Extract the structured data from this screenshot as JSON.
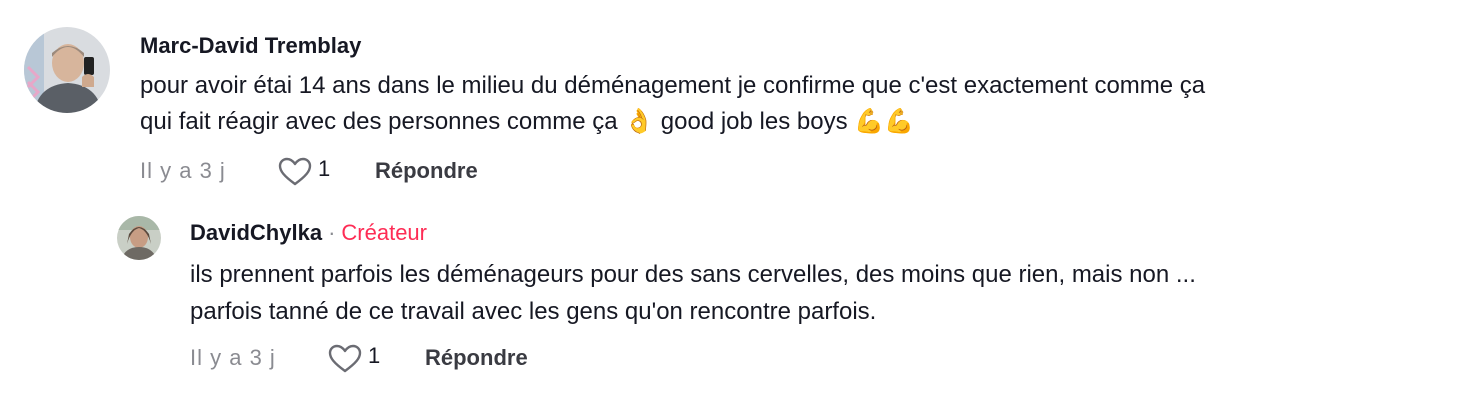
{
  "comments": [
    {
      "author": "Marc-David Tremblay",
      "text_line1": "pour avoir étai 14 ans dans le milieu du déménagement je confirme que c'est exactement comme ça",
      "text_line2": "qui fait réagir avec des personnes comme ça 👌 good job les boys 💪💪",
      "time": "Il y a 3 j",
      "likes": "1",
      "reply_label": "Répondre"
    }
  ],
  "reply": {
    "author": "DavidChylka",
    "separator": "·",
    "badge": "Créateur",
    "text_line1": "ils prennent parfois les déménageurs pour des sans cervelles, des moins que rien, mais non ...",
    "text_line2": "parfois tanné de ce travail avec les gens qu'on rencontre parfois.",
    "time": "Il y a 3 j",
    "likes": "1",
    "reply_label": "Répondre"
  },
  "colors": {
    "text": "#161823",
    "muted": "#8a8b91",
    "creator_badge": "#fe2c55"
  },
  "icons": {
    "like": "heart-outline-icon"
  }
}
